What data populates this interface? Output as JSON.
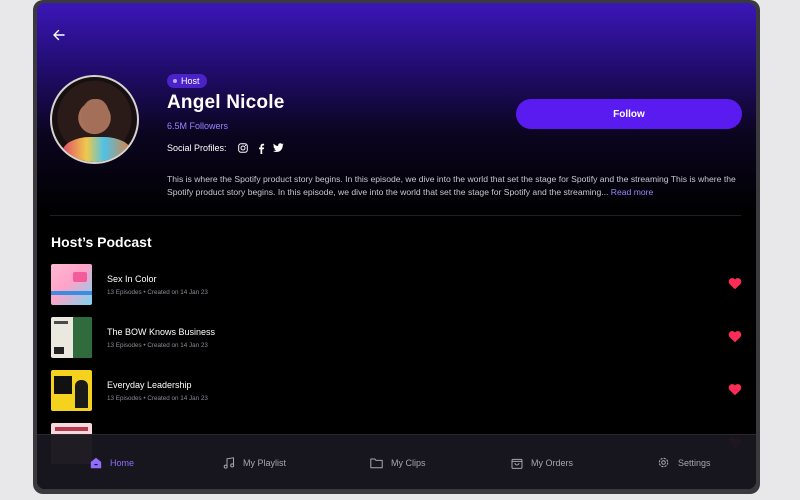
{
  "header": {
    "badge": "Host",
    "name": "Angel Nicole",
    "followers": "6.5M Followers",
    "social_label": "Social Profiles:",
    "social_icons": [
      "instagram-icon",
      "facebook-icon",
      "twitter-icon"
    ],
    "follow_label": "Follow",
    "description": "This is where the Spotify product story begins. In this episode, we dive into the world that set the stage for Spotify and the streaming This is where the Spotify product story begins. In this episode, we dive into the world that set the stage for Spotify and the streaming...",
    "read_more": "Read more"
  },
  "section": {
    "title": "Host’s Podcast"
  },
  "podcasts": [
    {
      "title": "Sex In Color",
      "meta": "13 Episodes • Created on 14 Jan 23"
    },
    {
      "title": "The BOW Knows Business",
      "meta": "13 Episodes • Created on 14 Jan 23"
    },
    {
      "title": "Everyday Leadership",
      "meta": "13 Episodes • Created on 14 Jan 23"
    }
  ],
  "nav": {
    "items": [
      {
        "label": "Home",
        "icon": "home-icon",
        "active": true
      },
      {
        "label": "My Playlist",
        "icon": "music-note-icon",
        "active": false
      },
      {
        "label": "My Clips",
        "icon": "folder-icon",
        "active": false
      },
      {
        "label": "My Orders",
        "icon": "shopping-bag-icon",
        "active": false
      },
      {
        "label": "Settings",
        "icon": "gear-icon",
        "active": false
      }
    ]
  },
  "colors": {
    "accent": "#5a1bf0",
    "accent_text": "#9b84ff",
    "heart": "#ff2d55",
    "background": "#000000"
  }
}
